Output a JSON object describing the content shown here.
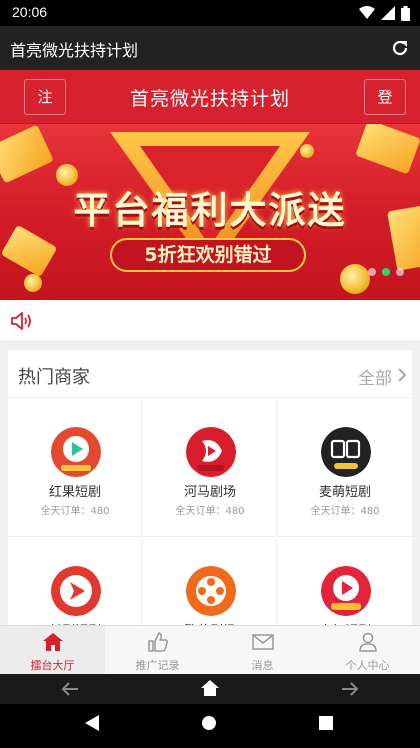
{
  "status_bar": {
    "time": "20:06"
  },
  "browser": {
    "title": "首亮微光扶持计划"
  },
  "header": {
    "title": "首亮微光扶持计划",
    "register_label": "注册",
    "login_label": "登录"
  },
  "banner": {
    "headline": "平台福利大派送",
    "subline": "5折狂欢别错过"
  },
  "merchants": {
    "title": "热门商家",
    "all_label": "全部",
    "items": [
      {
        "name": "红果短剧",
        "orders": "全天订单：480",
        "logo": "play-icon",
        "color": "#e2492f"
      },
      {
        "name": "河马剧场",
        "orders": "全天订单：480",
        "logo": "hippo-icon",
        "color": "#d81e2c"
      },
      {
        "name": "麦萌短剧",
        "orders": "全天订单：480",
        "logo": "duanju-icon",
        "color": "#222222"
      },
      {
        "name": "长剧短剧",
        "orders": "",
        "logo": "play-arrow-icon",
        "color": "#e03a2f"
      },
      {
        "name": "繁花剧场",
        "orders": "",
        "logo": "film-reel-icon",
        "color": "#f06a1e"
      },
      {
        "name": "小红短剧",
        "orders": "",
        "logo": "free-play-icon",
        "color": "#e3243a"
      }
    ]
  },
  "tabs": [
    {
      "label": "擂台大厅",
      "icon": "home-icon",
      "active": true
    },
    {
      "label": "推广记录",
      "icon": "thumbs-up-icon",
      "active": false
    },
    {
      "label": "消息",
      "icon": "mail-icon",
      "active": false
    },
    {
      "label": "个人中心",
      "icon": "person-icon",
      "active": false
    }
  ],
  "colors": {
    "brand_red": "#d6222f",
    "inactive": "#999999"
  }
}
